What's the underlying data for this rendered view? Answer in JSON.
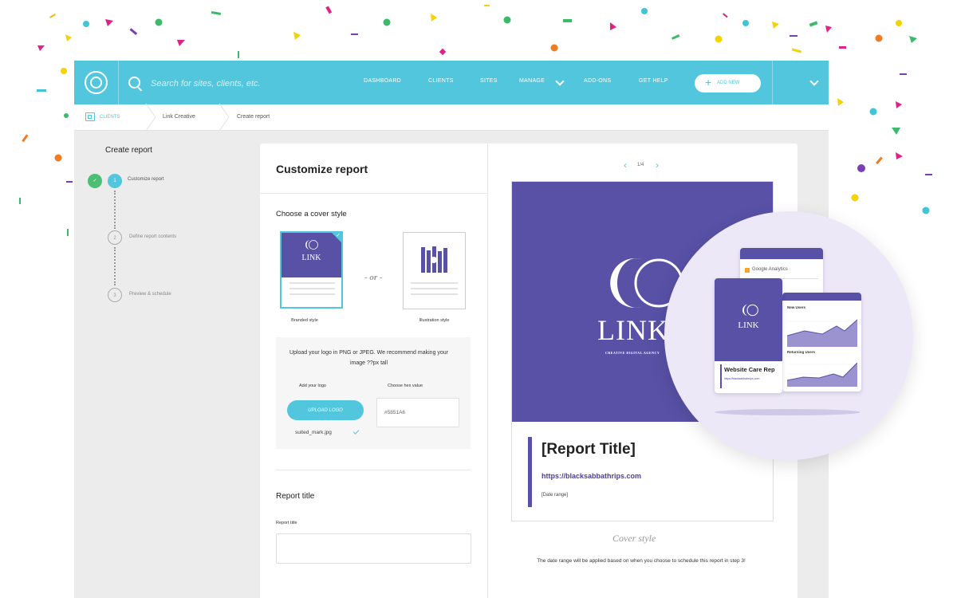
{
  "colors": {
    "accent": "#51c6dc",
    "brand_purple": "#5851a6",
    "success": "#4cbf72"
  },
  "topbar": {
    "search_placeholder": "Search for sites, clients, etc.",
    "nav": [
      "DASHBOARD",
      "CLIENTS",
      "SITES",
      "MANAGE",
      "ADD-ONS",
      "GET HELP"
    ],
    "add_new_label": "ADD NEW"
  },
  "breadcrumb": [
    "CLIENTS",
    "Link Creative",
    "Create report"
  ],
  "steps": {
    "title": "Create report",
    "items": [
      {
        "num": "1",
        "label": "Customize report"
      },
      {
        "num": "2",
        "label": "Define report contents"
      },
      {
        "num": "3",
        "label": "Preview & schedule"
      }
    ]
  },
  "customize": {
    "title": "Customize report",
    "cover_heading": "Choose a cover style",
    "branded_label": "Branded style",
    "illustration_label": "Illustration style",
    "or_text": "- or -",
    "card_logo_text": "LINK",
    "upload_info": "Upload your logo in PNG or JPEG. We recommend making your image ??px tall",
    "add_logo_label": "Add your logo",
    "hex_label": "Choose hex value",
    "upload_button": "UPLOAD LOGO",
    "hex_value": "#5851A6",
    "file_name": "suited_mark.jpg",
    "report_title_heading": "Report title",
    "report_title_label": "Report title"
  },
  "preview": {
    "page_indicator": "1/4",
    "logo_text": "LINK",
    "tagline": "CREATIVE DIGITAL AGENCY",
    "report_title": "[Report Title]",
    "url": "https://blacksabbathrips.com",
    "date_range": "[Date range]",
    "caption": "Cover style",
    "note": "The date range will be applied based on when you choose to schedule this report in step 3!"
  },
  "illustration": {
    "ga_label": "Google Analytics",
    "mini_link": "LINK",
    "mini_report_title": "Website Care Rep",
    "mini_url": "https://blacksabbathrips.com",
    "new_users": "New Users",
    "returning_users": "Returning Users"
  }
}
